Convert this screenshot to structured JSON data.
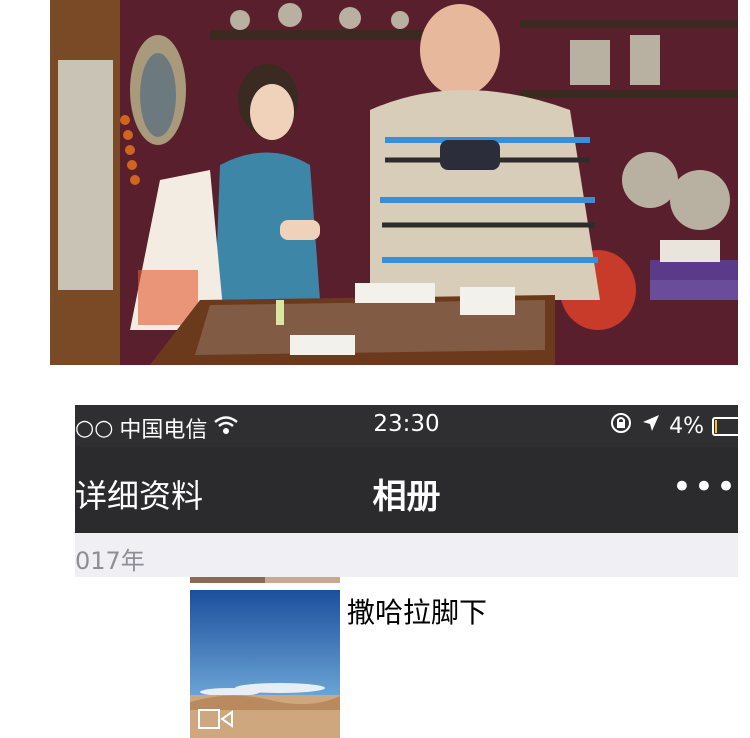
{
  "photo": {
    "description_icon": "shop-photo"
  },
  "status_bar": {
    "carrier": "中国电信",
    "signal_dots": "○○",
    "time": "23:30",
    "battery": "4%"
  },
  "nav": {
    "back_label": "详细资料",
    "title": "相册",
    "more_label": "•••"
  },
  "album": {
    "section_year": "017年",
    "items": [
      {
        "caption": "撒哈拉脚下",
        "type": "video"
      }
    ]
  }
}
